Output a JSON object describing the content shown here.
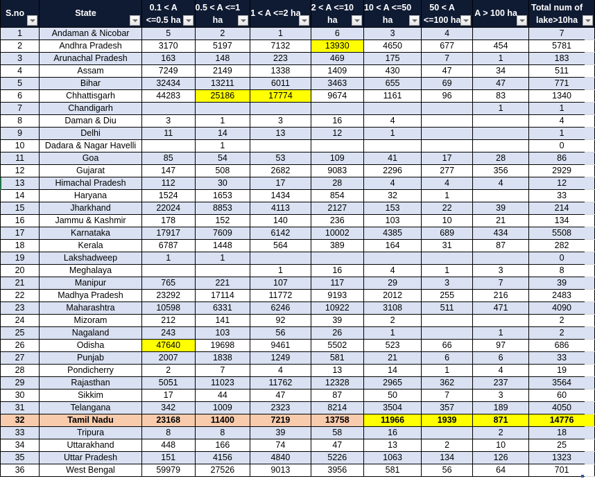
{
  "table": {
    "columns": [
      {
        "label_lines": [
          "S.no"
        ]
      },
      {
        "label_lines": [
          "State"
        ]
      },
      {
        "label_lines": [
          "0.1 < A",
          "<=0.5 ha"
        ]
      },
      {
        "label_lines": [
          "0.5 < A <=1",
          "ha"
        ]
      },
      {
        "label_lines": [
          "1 < A <=2 ha"
        ]
      },
      {
        "label_lines": [
          "2 < A <=10",
          "ha"
        ]
      },
      {
        "label_lines": [
          "10 < A <=50",
          "ha"
        ]
      },
      {
        "label_lines": [
          "50 < A",
          "<=100 ha"
        ]
      },
      {
        "label_lines": [
          "A > 100 ha"
        ]
      },
      {
        "label_lines": [
          "Total num of",
          "lake>10ha"
        ]
      }
    ],
    "highlight_colors": {
      "yellow": "#ffff00",
      "selected_row": "#f8cbad",
      "band": "#d9e1f2",
      "header": "#0f1b33"
    },
    "rows": [
      {
        "sno": "1",
        "state": "Andaman & Nicobar",
        "values": [
          "5",
          "2",
          "1",
          "6",
          "3",
          "4",
          "",
          "7"
        ]
      },
      {
        "sno": "2",
        "state": "Andhra Pradesh",
        "values": [
          "3170",
          "5197",
          "7132",
          "13930",
          "4650",
          "677",
          "454",
          "5781"
        ],
        "yellow": [
          3
        ]
      },
      {
        "sno": "3",
        "state": "Arunachal Pradesh",
        "values": [
          "163",
          "148",
          "223",
          "469",
          "175",
          "7",
          "1",
          "183"
        ]
      },
      {
        "sno": "4",
        "state": "Assam",
        "values": [
          "7249",
          "2149",
          "1338",
          "1409",
          "430",
          "47",
          "34",
          "511"
        ]
      },
      {
        "sno": "5",
        "state": "Bihar",
        "values": [
          "32434",
          "13211",
          "6011",
          "3463",
          "655",
          "69",
          "47",
          "771"
        ]
      },
      {
        "sno": "6",
        "state": "Chhattisgarh",
        "values": [
          "44283",
          "25186",
          "17774",
          "9674",
          "1161",
          "96",
          "83",
          "1340"
        ],
        "yellow": [
          1,
          2
        ]
      },
      {
        "sno": "7",
        "state": "Chandigarh",
        "values": [
          "",
          "",
          "",
          "",
          "",
          "",
          "1",
          "1"
        ]
      },
      {
        "sno": "8",
        "state": "Daman & Diu",
        "values": [
          "3",
          "1",
          "3",
          "16",
          "4",
          "",
          "",
          "4"
        ]
      },
      {
        "sno": "9",
        "state": "Delhi",
        "values": [
          "11",
          "14",
          "13",
          "12",
          "1",
          "",
          "",
          "1"
        ]
      },
      {
        "sno": "10",
        "state": "Dadara & Nagar Havelli",
        "values": [
          "",
          "1",
          "",
          "",
          "",
          "",
          "",
          "0"
        ]
      },
      {
        "sno": "11",
        "state": "Goa",
        "values": [
          "85",
          "54",
          "53",
          "109",
          "41",
          "17",
          "28",
          "86"
        ]
      },
      {
        "sno": "12",
        "state": "Gujarat",
        "values": [
          "147",
          "508",
          "2682",
          "9083",
          "2296",
          "277",
          "356",
          "2929"
        ]
      },
      {
        "sno": "13",
        "state": "Himachal Pradesh",
        "values": [
          "112",
          "30",
          "17",
          "28",
          "4",
          "4",
          "4",
          "12"
        ]
      },
      {
        "sno": "14",
        "state": "Haryana",
        "values": [
          "1524",
          "1653",
          "1434",
          "854",
          "32",
          "1",
          "",
          "33"
        ]
      },
      {
        "sno": "15",
        "state": "Jharkhand",
        "values": [
          "22024",
          "8853",
          "4113",
          "2127",
          "153",
          "22",
          "39",
          "214"
        ]
      },
      {
        "sno": "16",
        "state": "Jammu & Kashmir",
        "values": [
          "178",
          "152",
          "140",
          "236",
          "103",
          "10",
          "21",
          "134"
        ]
      },
      {
        "sno": "17",
        "state": "Karnataka",
        "values": [
          "17917",
          "7609",
          "6142",
          "10002",
          "4385",
          "689",
          "434",
          "5508"
        ]
      },
      {
        "sno": "18",
        "state": "Kerala",
        "values": [
          "6787",
          "1448",
          "564",
          "389",
          "164",
          "31",
          "87",
          "282"
        ]
      },
      {
        "sno": "19",
        "state": "Lakshadweep",
        "values": [
          "1",
          "1",
          "",
          "",
          "",
          "",
          "",
          "0"
        ]
      },
      {
        "sno": "20",
        "state": "Meghalaya",
        "values": [
          "",
          "",
          "1",
          "16",
          "4",
          "1",
          "3",
          "8"
        ]
      },
      {
        "sno": "21",
        "state": "Manipur",
        "values": [
          "765",
          "221",
          "107",
          "117",
          "29",
          "3",
          "7",
          "39"
        ]
      },
      {
        "sno": "22",
        "state": "Madhya Pradesh",
        "values": [
          "23292",
          "17114",
          "11772",
          "9193",
          "2012",
          "255",
          "216",
          "2483"
        ]
      },
      {
        "sno": "23",
        "state": "Maharashtra",
        "values": [
          "10598",
          "6331",
          "6246",
          "10922",
          "3108",
          "511",
          "471",
          "4090"
        ]
      },
      {
        "sno": "24",
        "state": "Mizoram",
        "values": [
          "212",
          "141",
          "92",
          "39",
          "2",
          "",
          "",
          "2"
        ]
      },
      {
        "sno": "25",
        "state": "Nagaland",
        "values": [
          "243",
          "103",
          "56",
          "26",
          "1",
          "",
          "1",
          "2"
        ]
      },
      {
        "sno": "26",
        "state": "Odisha",
        "values": [
          "47640",
          "19698",
          "9461",
          "5502",
          "523",
          "66",
          "97",
          "686"
        ],
        "yellow": [
          0
        ]
      },
      {
        "sno": "27",
        "state": "Punjab",
        "values": [
          "2007",
          "1838",
          "1249",
          "581",
          "21",
          "6",
          "6",
          "33"
        ]
      },
      {
        "sno": "28",
        "state": "Pondicherry",
        "values": [
          "2",
          "7",
          "4",
          "13",
          "14",
          "1",
          "4",
          "19"
        ]
      },
      {
        "sno": "29",
        "state": "Rajasthan",
        "values": [
          "5051",
          "11023",
          "11762",
          "12328",
          "2965",
          "362",
          "237",
          "3564"
        ]
      },
      {
        "sno": "30",
        "state": "Sikkim",
        "values": [
          "17",
          "44",
          "47",
          "87",
          "50",
          "7",
          "3",
          "60"
        ]
      },
      {
        "sno": "31",
        "state": "Telangana",
        "values": [
          "342",
          "1009",
          "2323",
          "8214",
          "3504",
          "357",
          "189",
          "4050"
        ]
      },
      {
        "sno": "32",
        "state": "Tamil Nadu",
        "values": [
          "23168",
          "11400",
          "7219",
          "13758",
          "11966",
          "1939",
          "871",
          "14776"
        ],
        "highlight": true,
        "yellow": [
          4,
          5,
          6,
          7
        ]
      },
      {
        "sno": "33",
        "state": "Tripura",
        "values": [
          "8",
          "8",
          "39",
          "58",
          "16",
          "",
          "2",
          "18"
        ]
      },
      {
        "sno": "34",
        "state": "Uttarakhand",
        "values": [
          "448",
          "166",
          "74",
          "47",
          "13",
          "2",
          "10",
          "25"
        ]
      },
      {
        "sno": "35",
        "state": "Uttar Pradesh",
        "values": [
          "151",
          "4156",
          "4840",
          "5226",
          "1063",
          "134",
          "126",
          "1323"
        ]
      },
      {
        "sno": "36",
        "state": "West Bengal",
        "values": [
          "59979",
          "27526",
          "9013",
          "3956",
          "581",
          "56",
          "64",
          "701"
        ]
      }
    ]
  }
}
